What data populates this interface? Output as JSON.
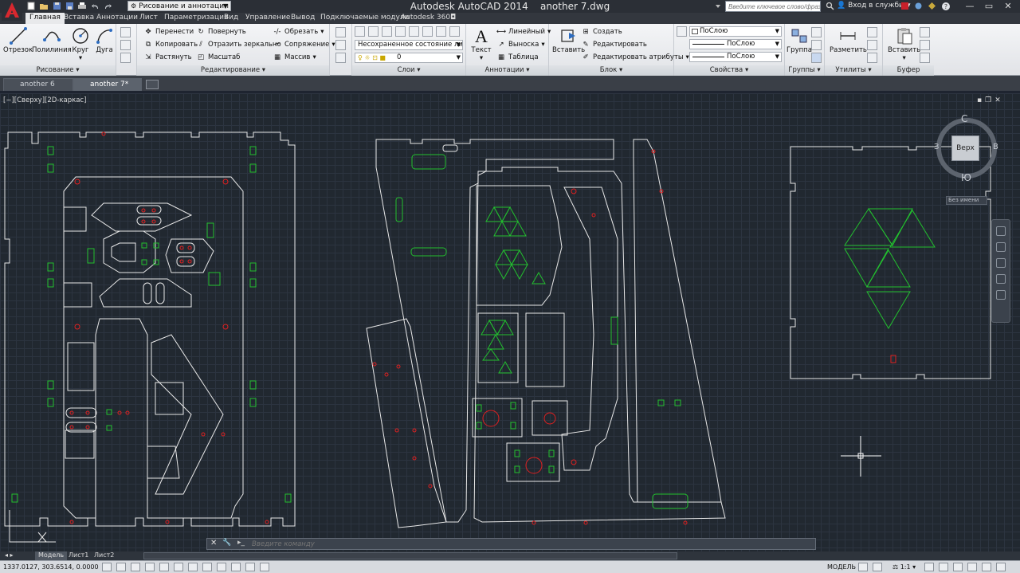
{
  "app": {
    "title": "Autodesk AutoCAD 2014",
    "file_name": "another 7.dwg",
    "workspace": "Рисование и аннотации",
    "search_placeholder": "Введите ключевое слово/фразу",
    "login": "Вход в службы"
  },
  "ribbon_tabs": [
    "Главная",
    "Вставка",
    "Аннотации",
    "Лист",
    "Параметризация",
    "Вид",
    "Управление",
    "Вывод",
    "Подключаемые модули",
    "Autodesk 360"
  ],
  "ribbon": {
    "draw": {
      "title": "Рисование",
      "line": "Отрезок",
      "polyline": "Полилиния",
      "circle": "Круг",
      "arc": "Дуга"
    },
    "modify": {
      "title": "Редактирование",
      "move": "Перенести",
      "rotate": "Повернуть",
      "trim": "Обрезать",
      "copy": "Копировать",
      "mirror": "Отразить зеркально",
      "fillet": "Сопряжение",
      "stretch": "Растянуть",
      "scale": "Масштаб",
      "array": "Массив"
    },
    "layers": {
      "title": "Слои",
      "layer_state": "Несохраненное состояние листа",
      "current_layer": "0"
    },
    "annotation": {
      "title": "Аннотации",
      "text": "Текст",
      "linear": "Линейный",
      "leader": "Выноска",
      "table": "Таблица"
    },
    "block": {
      "title": "Блок",
      "insert": "Вставить",
      "create": "Создать",
      "edit": "Редактировать",
      "edit_attributes": "Редактировать атрибуты"
    },
    "properties": {
      "title": "Свойства",
      "color": "ПоСлою",
      "linetype": "ПоСлою",
      "lineweight": "ПоСлою"
    },
    "groups": {
      "title": "Группы",
      "group": "Группа"
    },
    "utilities": {
      "title": "Утилиты",
      "measure": "Разметить"
    },
    "clipboard": {
      "title": "Буфер обмена",
      "paste": "Вставить"
    }
  },
  "file_tabs": [
    "another 6",
    "another 7*"
  ],
  "viewport": {
    "label": "[−][Сверху][2D-каркас]",
    "viewcube_face": "Верх",
    "dir_north": "С",
    "dir_south": "Ю",
    "dir_west": "З",
    "dir_east": "В",
    "wcs": "Без имени"
  },
  "command_line": {
    "placeholder": "Введите команду"
  },
  "layout_tabs": [
    "Модель",
    "Лист1",
    "Лист2"
  ],
  "status": {
    "coordinates": "1337.0127, 303.6514, 0.0000",
    "space": "МОДЕЛЬ",
    "scale": "1:1"
  },
  "colors": {
    "canvas": "#212830",
    "outline": "#e8e8e8",
    "green": "#22c02e",
    "red": "#e02020",
    "ribbon": "#eceef1"
  }
}
